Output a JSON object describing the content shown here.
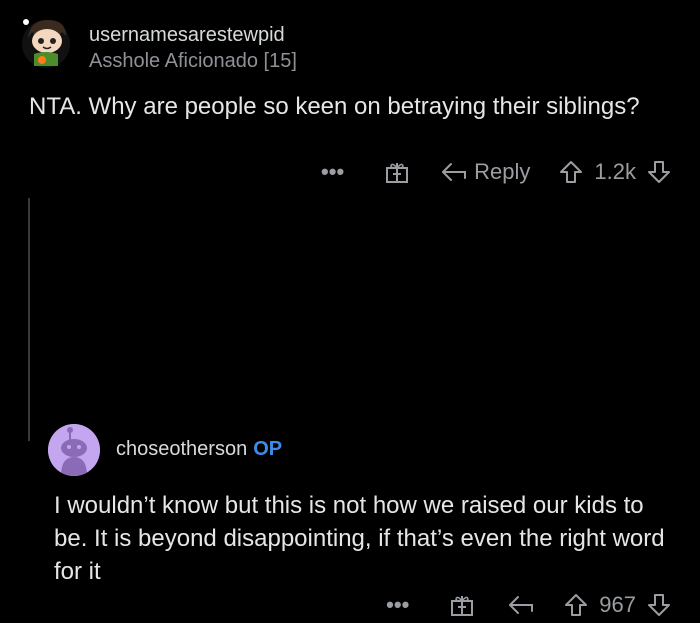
{
  "top_comment": {
    "author": "usernamesarestewpid",
    "flair": "Asshole Aficionado [15]",
    "body": "NTA. Why are people so keen on betraying their siblings?",
    "actions": {
      "more": "•••",
      "reply_label": "Reply",
      "vote_count": "1.2k"
    }
  },
  "reply_comment": {
    "author": "choseotherson",
    "op_badge": "OP",
    "body": "I wouldn’t know but this is not how we raised our kids to be. It is beyond disappointing, if that’s even the right word for it",
    "actions": {
      "more": "•••",
      "vote_count": "967"
    }
  },
  "colors": {
    "background": "#000000",
    "text": "#d7dadc",
    "muted": "#9a9da1",
    "op_badge": "#3d8ce6",
    "avatar_reply_bg": "#c4a6f0"
  }
}
